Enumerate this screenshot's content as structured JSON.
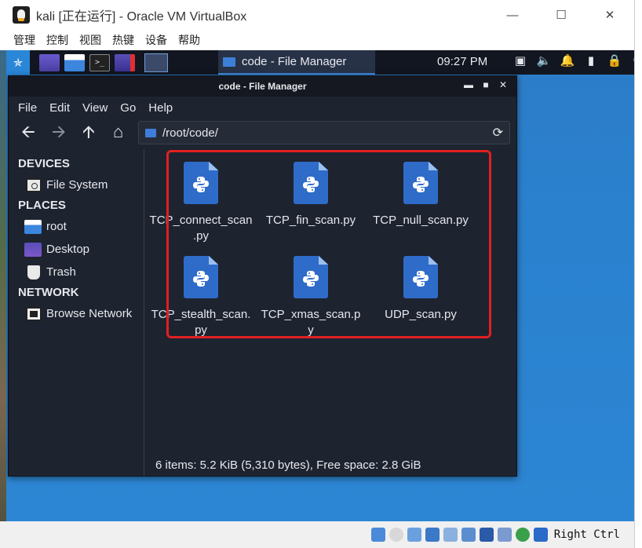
{
  "virtualbox": {
    "title": "kali [正在运行] - Oracle VM VirtualBox",
    "menu": [
      "管理",
      "控制",
      "视图",
      "热键",
      "设备",
      "帮助"
    ],
    "host_key": "Right Ctrl",
    "icons": [
      "audio-icon",
      "optical-drive-icon",
      "usb-icon",
      "network-icon",
      "shared-folder-icon",
      "display-icon",
      "video-capture-icon",
      "cpu-icon",
      "mouse-integration-icon",
      "keyboard-capture-icon"
    ]
  },
  "panel": {
    "task_label": "code - File Manager",
    "clock": "09:27 PM",
    "tray": [
      "network-icon",
      "volume-icon",
      "notification-icon",
      "battery-icon",
      "lock-icon",
      "power-icon"
    ]
  },
  "file_manager": {
    "title": "code - File Manager",
    "menu": [
      "File",
      "Edit",
      "View",
      "Go",
      "Help"
    ],
    "location": "/root/code/",
    "sidebar": {
      "devices_heading": "DEVICES",
      "devices": [
        {
          "label": "File System",
          "icon": "disk-icon"
        }
      ],
      "places_heading": "PLACES",
      "places": [
        {
          "label": "root",
          "icon": "folder-icon"
        },
        {
          "label": "Desktop",
          "icon": "desktop-icon"
        },
        {
          "label": "Trash",
          "icon": "trash-icon"
        }
      ],
      "network_heading": "NETWORK",
      "network": [
        {
          "label": "Browse Network",
          "icon": "network-icon"
        }
      ]
    },
    "files": [
      {
        "name": "TCP_connect_scan.py",
        "line1": "TCP_connect_scan",
        "line2": ".py"
      },
      {
        "name": "TCP_fin_scan.py",
        "line1": "TCP_fin_scan.py",
        "line2": ""
      },
      {
        "name": "TCP_null_scan.py",
        "line1": "TCP_null_scan.py",
        "line2": ""
      },
      {
        "name": "TCP_stealth_scan.py",
        "line1": "TCP_stealth_scan.",
        "line2": "py"
      },
      {
        "name": "TCP_xmas_scan.py",
        "line1": "TCP_xmas_scan.p",
        "line2": "y"
      },
      {
        "name": "UDP_scan.py",
        "line1": "UDP_scan.py",
        "line2": ""
      }
    ],
    "status": "6 items: 5.2 KiB (5,310 bytes), Free space: 2.8 GiB"
  },
  "colors": {
    "kali_blue": "#2d7cc8",
    "fm_background": "#1e2330",
    "python_icon": "#2f6cc9",
    "highlight_box": "#e02020"
  }
}
